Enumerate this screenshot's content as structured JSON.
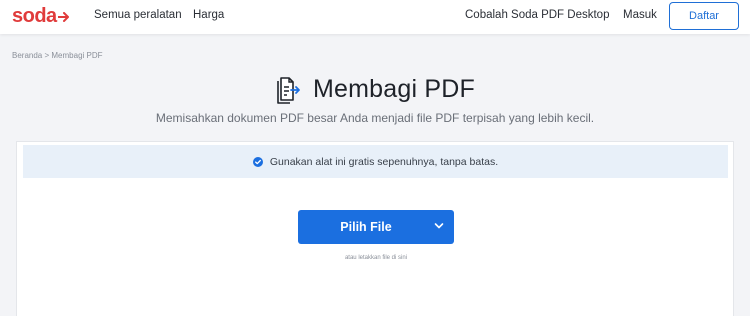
{
  "header": {
    "logo_text": "soda",
    "brand_color": "#e03b3b",
    "nav": {
      "tools": "Semua peralatan",
      "pricing": "Harga"
    },
    "desktop_link": "Cobalah Soda PDF Desktop",
    "login": "Masuk",
    "signup": "Daftar"
  },
  "breadcrumb": {
    "home": "Beranda",
    "separator": ">",
    "current": "Membagi PDF"
  },
  "main": {
    "title": "Membagi PDF",
    "title_icon": "split-pdf-icon",
    "subtitle": "Memisahkan dokumen PDF besar Anda menjadi file PDF terpisah yang lebih kecil.",
    "notice": {
      "icon": "check-circle-icon",
      "text": "Gunakan alat ini gratis sepenuhnya, tanpa batas.",
      "background": "#e8f0f9"
    },
    "upload": {
      "button_label": "Pilih File",
      "dropdown_icon": "chevron-down-icon",
      "button_color": "#1b6fe0",
      "drop_hint": "atau letakkan file di sini"
    }
  }
}
